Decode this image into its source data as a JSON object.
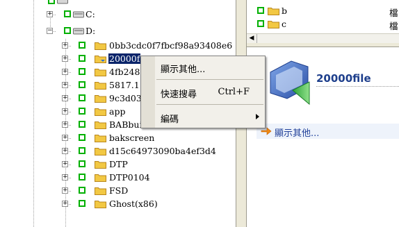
{
  "tree": {
    "items": [
      {
        "label": "C:",
        "kind": "drive",
        "expander": "+"
      },
      {
        "label": "D:",
        "kind": "drive",
        "expander": "−"
      },
      {
        "label": "0bb3cdc0f7fbcf98a93408e6",
        "kind": "folder",
        "expander": "+"
      },
      {
        "label": "20000f",
        "kind": "folder",
        "expander": "+",
        "selected": true
      },
      {
        "label": "4fb248",
        "kind": "folder",
        "expander": "+"
      },
      {
        "label": "5817.1",
        "kind": "folder",
        "expander": "+"
      },
      {
        "label": "9c3d03",
        "kind": "folder",
        "expander": "+"
      },
      {
        "label": "app",
        "kind": "folder",
        "expander": "+"
      },
      {
        "label": "BABbuild",
        "kind": "folder",
        "expander": "+"
      },
      {
        "label": "bakscreen",
        "kind": "folder",
        "expander": "+"
      },
      {
        "label": "d15c64973090ba4ef3d4",
        "kind": "folder",
        "expander": "+"
      },
      {
        "label": "DTP",
        "kind": "folder",
        "expander": "+"
      },
      {
        "label": "DTP0104",
        "kind": "folder",
        "expander": "+"
      },
      {
        "label": "FSD",
        "kind": "folder",
        "expander": "+"
      },
      {
        "label": "Ghost(x86)",
        "kind": "folder",
        "expander": "+"
      }
    ]
  },
  "file_list": {
    "rows": [
      {
        "name": "b",
        "type": "檔"
      },
      {
        "name": "c",
        "type": "檔"
      }
    ]
  },
  "info_panel": {
    "title": "20000file",
    "action_label": "顯示其他..."
  },
  "context_menu": {
    "items": [
      {
        "label": "顯示其他...",
        "shortcut": ""
      },
      {
        "label": "快速搜尋",
        "shortcut": "Ctrl+F"
      },
      {
        "label": "編碼",
        "shortcut": ""
      }
    ]
  },
  "colors": {
    "selection": "#0a246a",
    "checkbox": "#00b000",
    "folder": "#f2c843",
    "link": "#1f3f99"
  }
}
